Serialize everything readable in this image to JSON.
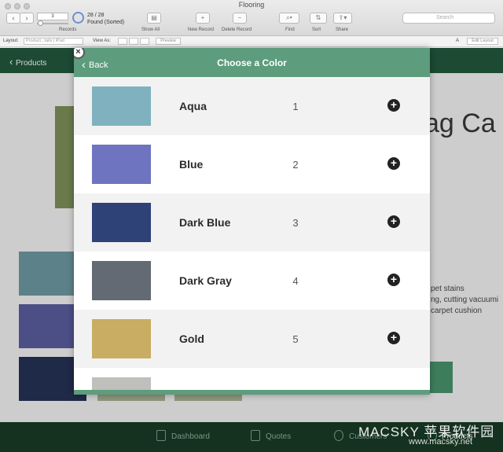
{
  "window": {
    "title": "Flooring"
  },
  "toolbar": {
    "prev_icon": "chevron-left-icon",
    "next_icon": "chevron-right-icon",
    "record_number": "3",
    "records_label": "Records",
    "found_count": "28 / 28",
    "found_status": "Found (Sorted)",
    "show_all_label": "Show All",
    "new_record_label": "New Record",
    "delete_record_label": "Delete Record",
    "find_label": "Find",
    "sort_label": "Sort",
    "share_label": "Share",
    "search_placeholder": "Search"
  },
  "layout_bar": {
    "layout_label": "Layout:",
    "layout_value": "Product...tails | iPad",
    "view_as_label": "View As:",
    "preview_label": "Preview",
    "font_icon": "A",
    "edit_layout_label": "Edit Layout"
  },
  "app": {
    "back_label": "Products",
    "title_fragment": "ag Ca",
    "detail_lines": [
      "pet stains",
      "ng, cutting vacuumi",
      "carpet cushion"
    ],
    "footer_tabs": [
      {
        "label": "Dashboard",
        "icon": "dashboard-icon"
      },
      {
        "label": "Quotes",
        "icon": "quotes-icon"
      },
      {
        "label": "Customers",
        "icon": "customers-icon"
      },
      {
        "label": "Products",
        "icon": "products-icon"
      }
    ]
  },
  "modal": {
    "back_label": "Back",
    "title": "Choose a Color",
    "close_icon": "close-icon",
    "colors": [
      {
        "name": "Aqua",
        "number": "1",
        "swatch": "#7fb2be"
      },
      {
        "name": "Blue",
        "number": "2",
        "swatch": "#6e74bf"
      },
      {
        "name": "Dark Blue",
        "number": "3",
        "swatch": "#2f4277"
      },
      {
        "name": "Dark Gray",
        "number": "4",
        "swatch": "#646a73"
      },
      {
        "name": "Gold",
        "number": "5",
        "swatch": "#c8ad62"
      },
      {
        "name": "",
        "number": "",
        "swatch": "#bfbfbb"
      }
    ]
  },
  "watermark": {
    "brand": "MACSKY 苹果软件园",
    "url": "www.macsky.net"
  }
}
